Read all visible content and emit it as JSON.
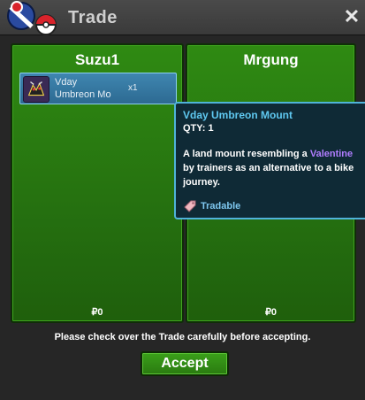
{
  "window": {
    "title": "Trade",
    "close_glyph": "✕"
  },
  "left_panel": {
    "player_name": "Suzu1",
    "money": "₽0",
    "item": {
      "name_line1": "Vday",
      "name_line2": "Umbreon Mo",
      "qty": "x1",
      "icon": "umbreon-mount-icon"
    }
  },
  "right_panel": {
    "player_name": "Mrgung",
    "money": "₽0"
  },
  "tooltip": {
    "title": "Vday Umbreon Mount",
    "qty": "QTY: 1",
    "desc_line1_pre": "A land mount resembling a ",
    "desc_line1_highlight": "Valentine",
    "desc_line2": "by trainers as an alternative to a bike",
    "desc_line3": "journey.",
    "tag": "Tradable"
  },
  "notice": "Please check over the Trade carefully before accepting.",
  "accept_label": "Accept",
  "colors": {
    "panel_green": "#2f8a12",
    "tooltip_border": "#4fb3d9",
    "tooltip_title": "#5fc8f0",
    "highlight_purple": "#b07dff"
  }
}
